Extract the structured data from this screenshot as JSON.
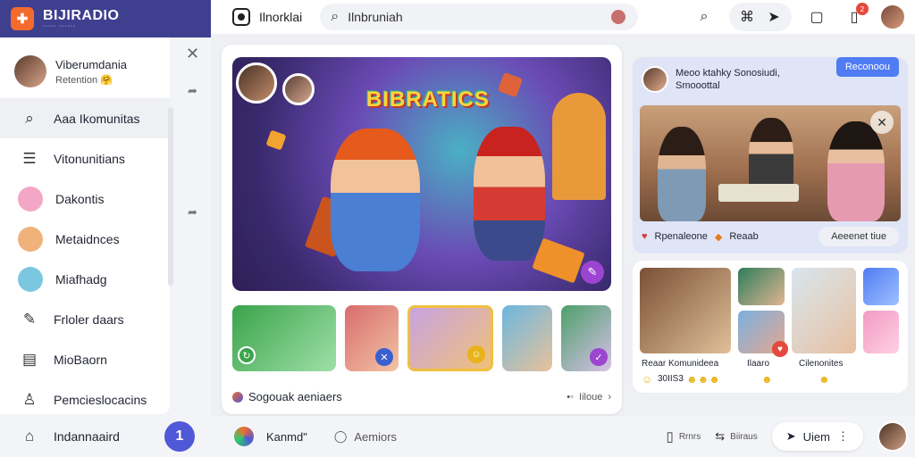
{
  "brand": {
    "name": "BIJIRADIO",
    "sub": "◦◦◦◦◦ ◦◦◦◦◦◦",
    "logo_icon": "cross-logo-icon"
  },
  "topbar": {
    "app_title": "Ilnorklai",
    "search": {
      "value": "Ilnbruniah",
      "placeholder": "Ilnbruniah"
    },
    "badge_count": "2"
  },
  "sidebar": {
    "profile": {
      "name": "Viberumdania",
      "status": "Retention 🤗"
    },
    "items": [
      {
        "label": "Aaa Ikomunitas",
        "icon": "search-icon"
      },
      {
        "label": "Vitonunitians",
        "icon": "list-icon"
      },
      {
        "label": "Dakontis",
        "icon": "avatar-icon"
      },
      {
        "label": "Metaidnces",
        "icon": "avatar-icon"
      },
      {
        "label": "Miafhadg",
        "icon": "avatar-icon"
      },
      {
        "label": "Frloler daars",
        "icon": "edit-icon"
      },
      {
        "label": "MioBaorn",
        "icon": "list-icon"
      },
      {
        "label": "Pemcieslocacins",
        "icon": "user-icon"
      }
    ],
    "bottom": {
      "label": "Indannaaird",
      "button": "1"
    }
  },
  "main": {
    "hero_title": "BIBRATICS",
    "footer_left": "Sogouak aeniaers",
    "footer_right": "Iiloue"
  },
  "right_top": {
    "text_line1": "Meoo ktahky Sonosiudi,",
    "text_line2": "Smooottal",
    "button": "Reconoou",
    "footer_item1": "Rpenaleone",
    "footer_item2": "Reaab",
    "footer_button": "Aeeenet tiue"
  },
  "right_bottom": {
    "label1": "Reaar Komunideea",
    "label1_count": "30IIS3",
    "label2": "Ilaaro",
    "label3": "Cilenonites"
  },
  "bottombar": {
    "label": "Kanmd\"",
    "chat": "Aemiors",
    "item1": "Rrnrs",
    "item2": "Biiraus",
    "button": "Uiem"
  },
  "colors": {
    "accent": "#4f58d6",
    "brand_bg": "#3f3f8f",
    "orange": "#f26b2d"
  }
}
